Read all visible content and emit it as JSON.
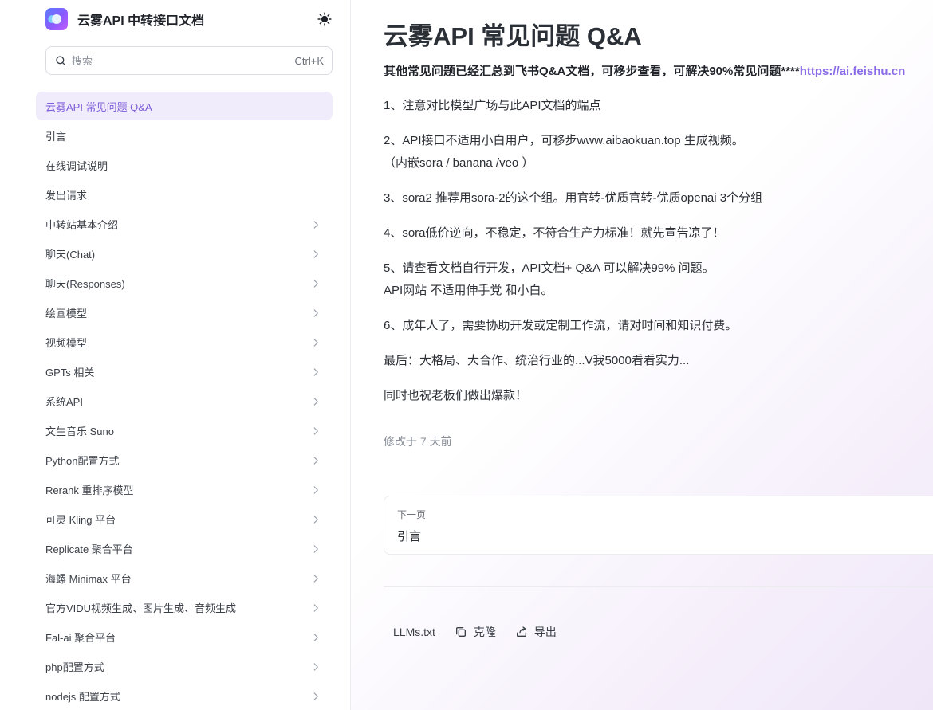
{
  "brand": {
    "title": "云雾API 中转接口文档"
  },
  "search": {
    "placeholder": "搜索",
    "shortcut": "Ctrl+K"
  },
  "sidebar": {
    "items": [
      {
        "label": "云雾API 常见问题 Q&A",
        "active": true,
        "chevron": false
      },
      {
        "label": "引言",
        "chevron": false
      },
      {
        "label": "在线调试说明",
        "chevron": false
      },
      {
        "label": "发出请求",
        "chevron": false
      },
      {
        "label": "中转站基本介绍",
        "chevron": true
      },
      {
        "label": "聊天(Chat)",
        "chevron": true
      },
      {
        "label": "聊天(Responses)",
        "chevron": true
      },
      {
        "label": "绘画模型",
        "chevron": true
      },
      {
        "label": "视频模型",
        "chevron": true
      },
      {
        "label": "GPTs 相关",
        "chevron": true
      },
      {
        "label": "系统API",
        "chevron": true
      },
      {
        "label": "文生音乐 Suno",
        "chevron": true
      },
      {
        "label": "Python配置方式",
        "chevron": true
      },
      {
        "label": "Rerank 重排序模型",
        "chevron": true
      },
      {
        "label": "可灵 Kling 平台",
        "chevron": true
      },
      {
        "label": "Replicate 聚合平台",
        "chevron": true
      },
      {
        "label": "海螺 Minimax 平台",
        "chevron": true
      },
      {
        "label": "官方VIDU视频生成、图片生成、音频生成",
        "chevron": true
      },
      {
        "label": "Fal-ai 聚合平台",
        "chevron": true
      },
      {
        "label": "php配置方式",
        "chevron": true
      },
      {
        "label": "nodejs 配置方式",
        "chevron": true
      }
    ]
  },
  "main": {
    "title": "云雾API 常见问题 Q&A",
    "intro_text": "其他常见问题已经汇总到飞书Q&A文档，可移步查看，可解决90%常见问题****",
    "intro_link": "https://ai.feishu.cn",
    "paragraphs": [
      {
        "lines": [
          "1、注意对比模型广场与此API文档的端点"
        ]
      },
      {
        "lines": [
          "2、API接口不适用小白用户，可移步www.aibaokuan.top 生成视频。",
          "（内嵌sora / banana /veo ）"
        ]
      },
      {
        "lines": [
          "3、sora2 推荐用sora-2的这个组。用官转-优质官转-优质openai 3个分组"
        ]
      },
      {
        "lines": [
          "4、sora低价逆向，不稳定，不符合生产力标准！就先宣告凉了！"
        ]
      },
      {
        "lines": [
          "5、请查看文档自行开发，API文档+ Q&A 可以解决99% 问题。",
          "API网站 不适用伸手党 和小白。"
        ]
      },
      {
        "lines": [
          "6、成年人了，需要协助开发或定制工作流，请对时间和知识付费。"
        ]
      },
      {
        "lines": [
          "最后：大格局、大合作、统治行业的...V我5000看看实力..."
        ]
      },
      {
        "lines": [
          "同时也祝老板们做出爆款！"
        ]
      }
    ],
    "modified": "修改于 7 天前",
    "next": {
      "label": "下一页",
      "title": "引言"
    },
    "footer": {
      "llms": "LLMs.txt",
      "clone": "克隆",
      "export": "导出"
    }
  },
  "colors": {
    "accent": "#8a6be6",
    "active_bg": "#f1ecfb"
  }
}
